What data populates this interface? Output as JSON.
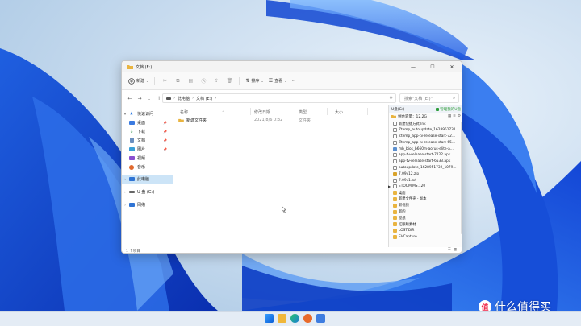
{
  "window": {
    "title": "文档 (E:)",
    "controls": {
      "minimize": "—",
      "maximize": "☐",
      "close": "✕"
    }
  },
  "toolbar": {
    "new_label": "新建",
    "sort_label": "排序",
    "view_label": "查看",
    "more_label": "···"
  },
  "address": {
    "segments": [
      "此电脑",
      "文档 (E:)"
    ],
    "search_placeholder": "搜索\"文档 (E:)\""
  },
  "sidebar": {
    "items": [
      {
        "label": "快速访问",
        "level": 0
      },
      {
        "label": "桌面",
        "level": 1,
        "pinned": true
      },
      {
        "label": "下载",
        "level": 1,
        "pinned": true
      },
      {
        "label": "文档",
        "level": 1,
        "pinned": true
      },
      {
        "label": "图片",
        "level": 1,
        "pinned": true
      },
      {
        "label": "视频",
        "level": 1
      },
      {
        "label": "音乐",
        "level": 1
      },
      {
        "label": "此电脑",
        "level": 0,
        "selected": true
      },
      {
        "label": "U 盘 (G:)",
        "level": 0
      },
      {
        "label": "网络",
        "level": 0
      }
    ]
  },
  "columns": {
    "name": "名称",
    "date": "修改日期",
    "type": "类型",
    "size": "大小"
  },
  "files": [
    {
      "name": "新建文件夹",
      "date": "2021/8/6 0:32",
      "type": "文件夹"
    }
  ],
  "status": {
    "count": "1 个项目"
  },
  "panel": {
    "disk": "U盘(G:)",
    "action": "管理我的U盘",
    "free": "剩余容量：12.2G",
    "items": [
      {
        "name": "新建快捷方式.lnk",
        "kind": "file"
      },
      {
        "name": "Ztemp_autoupdate_1628951731...",
        "kind": "file"
      },
      {
        "name": "Ztemp_app-tv-release-start-72...",
        "kind": "file"
      },
      {
        "name": "Ztemp_app-tv-release-start-65...",
        "kind": "file"
      },
      {
        "name": "mb_bios_b660m-aorus-elite-a...",
        "kind": "img"
      },
      {
        "name": "app-tv-release-start-7222.apk",
        "kind": "file"
      },
      {
        "name": "app-tv-release-start-6533.apk",
        "kind": "file"
      },
      {
        "name": "autoupdate_1628951739_1079...",
        "kind": "file"
      },
      {
        "name": "7.09v12.zip",
        "kind": "zip"
      },
      {
        "name": "7.09v1.txt",
        "kind": "file"
      },
      {
        "name": "ETOOMIMS.120",
        "kind": "file"
      },
      {
        "name": "桌面",
        "kind": "folder"
      },
      {
        "name": "新建文件夹 - 副本",
        "kind": "folder"
      },
      {
        "name": "新视频",
        "kind": "folder"
      },
      {
        "name": "新的",
        "kind": "folder"
      },
      {
        "name": "壁纸",
        "kind": "folder"
      },
      {
        "name": "红眼睛素材",
        "kind": "folder"
      },
      {
        "name": "LOST.DIR",
        "kind": "folder"
      },
      {
        "name": "EVCapture",
        "kind": "folder"
      }
    ]
  },
  "watermark": {
    "logo": "值",
    "text": "什么值得买"
  },
  "colors": {
    "accent": "#0067c0",
    "selected": "#cce4f7",
    "folder": "#e9b440",
    "green": "#2e9d3b"
  }
}
